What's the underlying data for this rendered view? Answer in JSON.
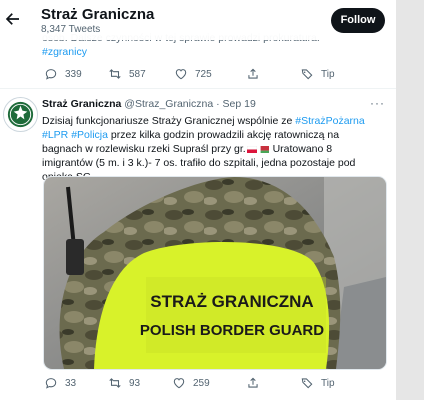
{
  "header": {
    "title": "Straż Graniczna",
    "tweet_count": "8,347 Tweets",
    "follow_label": "Follow"
  },
  "tweet1": {
    "text_partial": "osób. Dalsze czynności w tej sprawie prowadzi prokuratura.",
    "hashtag": "#zgranicy",
    "replies": "339",
    "retweets": "587",
    "likes": "725",
    "tip_label": "Tip"
  },
  "tweet2": {
    "name": "Straż Graniczna",
    "handle": "@Straz_Graniczna",
    "separator": "·",
    "date": "Sep 19",
    "more": "···",
    "text_a": "Dzisiaj funkcjonariusze Straży Granicznej wspólnie ze ",
    "tag1": "#StrażPożarna",
    "text_b": " ",
    "tag2": "#LPR",
    "tag3": "#Policja",
    "text_c": " przez kilka godzin prowadzili akcję ratowniczą na bagnach w rozlewisku rzeki Supraśl przy gr.",
    "text_d": " Uratowano 8 imigrantów (5 m. i 3 k.)- 7 os. trafiło do szpitali, jedna pozostaje pod opieką SG.",
    "image_text_line1": "STRAŻ GRANICZNA",
    "image_text_line2": "POLISH BORDER GUARD",
    "replies": "33",
    "retweets": "93",
    "likes": "259",
    "tip_label": "Tip"
  },
  "colors": {
    "accent": "#1d9bf0",
    "vest": "#d8f22a",
    "follow_bg": "#0f1419"
  }
}
